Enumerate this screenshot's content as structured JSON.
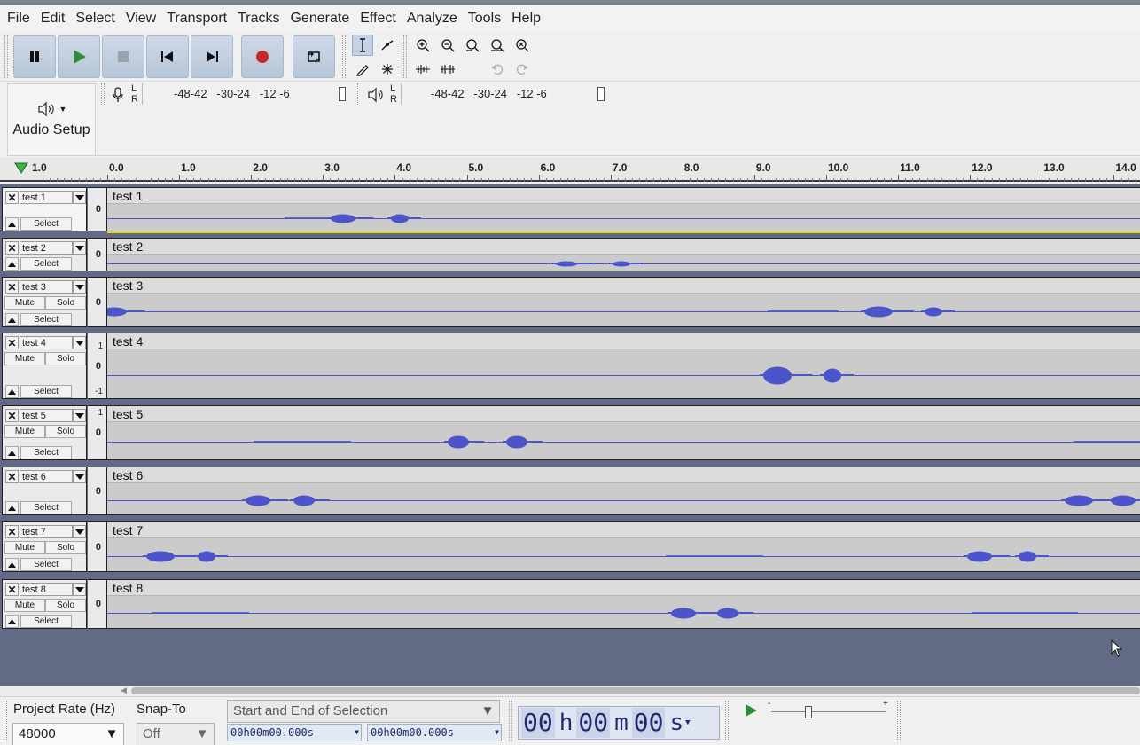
{
  "menu": [
    "File",
    "Edit",
    "Select",
    "View",
    "Transport",
    "Tracks",
    "Generate",
    "Effect",
    "Analyze",
    "Tools",
    "Help"
  ],
  "transport": {
    "buttons": [
      {
        "name": "pause",
        "icon": "pause-icon"
      },
      {
        "name": "play",
        "icon": "play-icon"
      },
      {
        "name": "stop",
        "icon": "stop-icon"
      },
      {
        "name": "skip-start",
        "icon": "skip-to-start-icon"
      },
      {
        "name": "skip-end",
        "icon": "skip-to-end-icon"
      },
      {
        "name": "record",
        "icon": "record-icon"
      },
      {
        "name": "loop",
        "icon": "loop-icon"
      }
    ]
  },
  "meters": {
    "record_scale": "-48-42   -30-24   -12 -6",
    "play_scale": "-48-42   -30-24   -12 -6",
    "L": "L",
    "R": "R"
  },
  "audio_setup": {
    "label": "Audio Setup"
  },
  "ruler": {
    "first_label": "1.0",
    "labels": [
      "0.0",
      "1.0",
      "2.0",
      "3.0",
      "4.0",
      "5.0",
      "6.0",
      "7.0",
      "8.0",
      "9.0",
      "10.0",
      "11.0",
      "12.0",
      "13.0",
      "14.0"
    ]
  },
  "tracks": [
    {
      "name": "test 1",
      "clip": "test 1",
      "mute": "",
      "solo": "",
      "select": "Select",
      "zero": "0",
      "top": "",
      "bottom": ""
    },
    {
      "name": "test 2",
      "clip": "test 2",
      "mute": "",
      "solo": "",
      "select": "Select",
      "zero": "0",
      "top": "",
      "bottom": ""
    },
    {
      "name": "test 3",
      "clip": "test 3",
      "mute": "Mute",
      "solo": "Solo",
      "select": "Select",
      "zero": "0",
      "top": "",
      "bottom": ""
    },
    {
      "name": "test 4",
      "clip": "test 4",
      "mute": "Mute",
      "solo": "Solo",
      "select": "Select",
      "zero": "0",
      "top": "1",
      "bottom": "-1"
    },
    {
      "name": "test 5",
      "clip": "test 5",
      "mute": "Mute",
      "solo": "Solo",
      "select": "Select",
      "zero": "0",
      "top": "1",
      "bottom": ""
    },
    {
      "name": "test 6",
      "clip": "test 6",
      "mute": "",
      "solo": "",
      "select": "Select",
      "zero": "0",
      "top": "",
      "bottom": ""
    },
    {
      "name": "test 7",
      "clip": "test 7",
      "mute": "Mute",
      "solo": "Solo",
      "select": "Select",
      "zero": "0",
      "top": "",
      "bottom": ""
    },
    {
      "name": "test 8",
      "clip": "test 8",
      "mute": "Mute",
      "solo": "Solo",
      "select": "Select",
      "zero": "0",
      "top": "",
      "bottom": ""
    }
  ],
  "selection_bar": {
    "project_rate_label": "Project Rate (Hz)",
    "project_rate_value": "48000",
    "snap_to_label": "Snap-To",
    "snap_to_value": "Off",
    "selection_mode": "Start and End of Selection",
    "start_time": "00h00m00.000s",
    "end_time": "00h00m00.000s",
    "big_time": {
      "h": "00",
      "m": "00",
      "s": "00",
      "h_unit": "h",
      "m_unit": "m",
      "s_unit": "s"
    }
  },
  "colors": {
    "waveform": "#4b55c9",
    "track_bg": "#cbcbcb",
    "tracks_area_bg": "#636a85",
    "selected_track_border": "#e2d900",
    "record_red": "#c62828",
    "play_green": "#2e8b3a"
  }
}
